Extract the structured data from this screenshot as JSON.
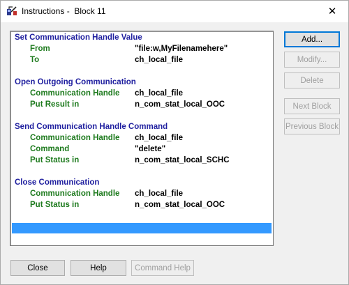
{
  "window": {
    "title": "Instructions -  Block 11",
    "app_icon": "network-cable-icon",
    "close_glyph": "✕"
  },
  "instructions": [
    {
      "heading": "Set Communication Handle Value",
      "params": [
        {
          "label": "From",
          "value": "\"file:w,MyFilenamehere\""
        },
        {
          "label": "To",
          "value": "ch_local_file"
        }
      ]
    },
    {
      "heading": "Open Outgoing Communication",
      "params": [
        {
          "label": "Communication Handle",
          "value": "ch_local_file"
        },
        {
          "label": "Put Result in",
          "value": "n_com_stat_local_OOC"
        }
      ]
    },
    {
      "heading": "Send Communication Handle Command",
      "params": [
        {
          "label": "Communication Handle",
          "value": "ch_local_file"
        },
        {
          "label": "Command",
          "value": "\"delete\""
        },
        {
          "label": "Put Status in",
          "value": "n_com_stat_local_SCHC"
        }
      ]
    },
    {
      "heading": "Close Communication",
      "params": [
        {
          "label": "Communication Handle",
          "value": "ch_local_file"
        },
        {
          "label": "Put Status in",
          "value": "n_com_stat_local_OOC"
        }
      ]
    }
  ],
  "buttons": {
    "add": "Add...",
    "modify": "Modify...",
    "delete": "Delete",
    "next_block": "Next Block",
    "previous_block": "Previous Block",
    "close": "Close",
    "help": "Help",
    "command_help": "Command Help"
  },
  "colors": {
    "heading": "#1f1f9f",
    "param_label": "#1d7a1d",
    "selection": "#3399ff"
  }
}
